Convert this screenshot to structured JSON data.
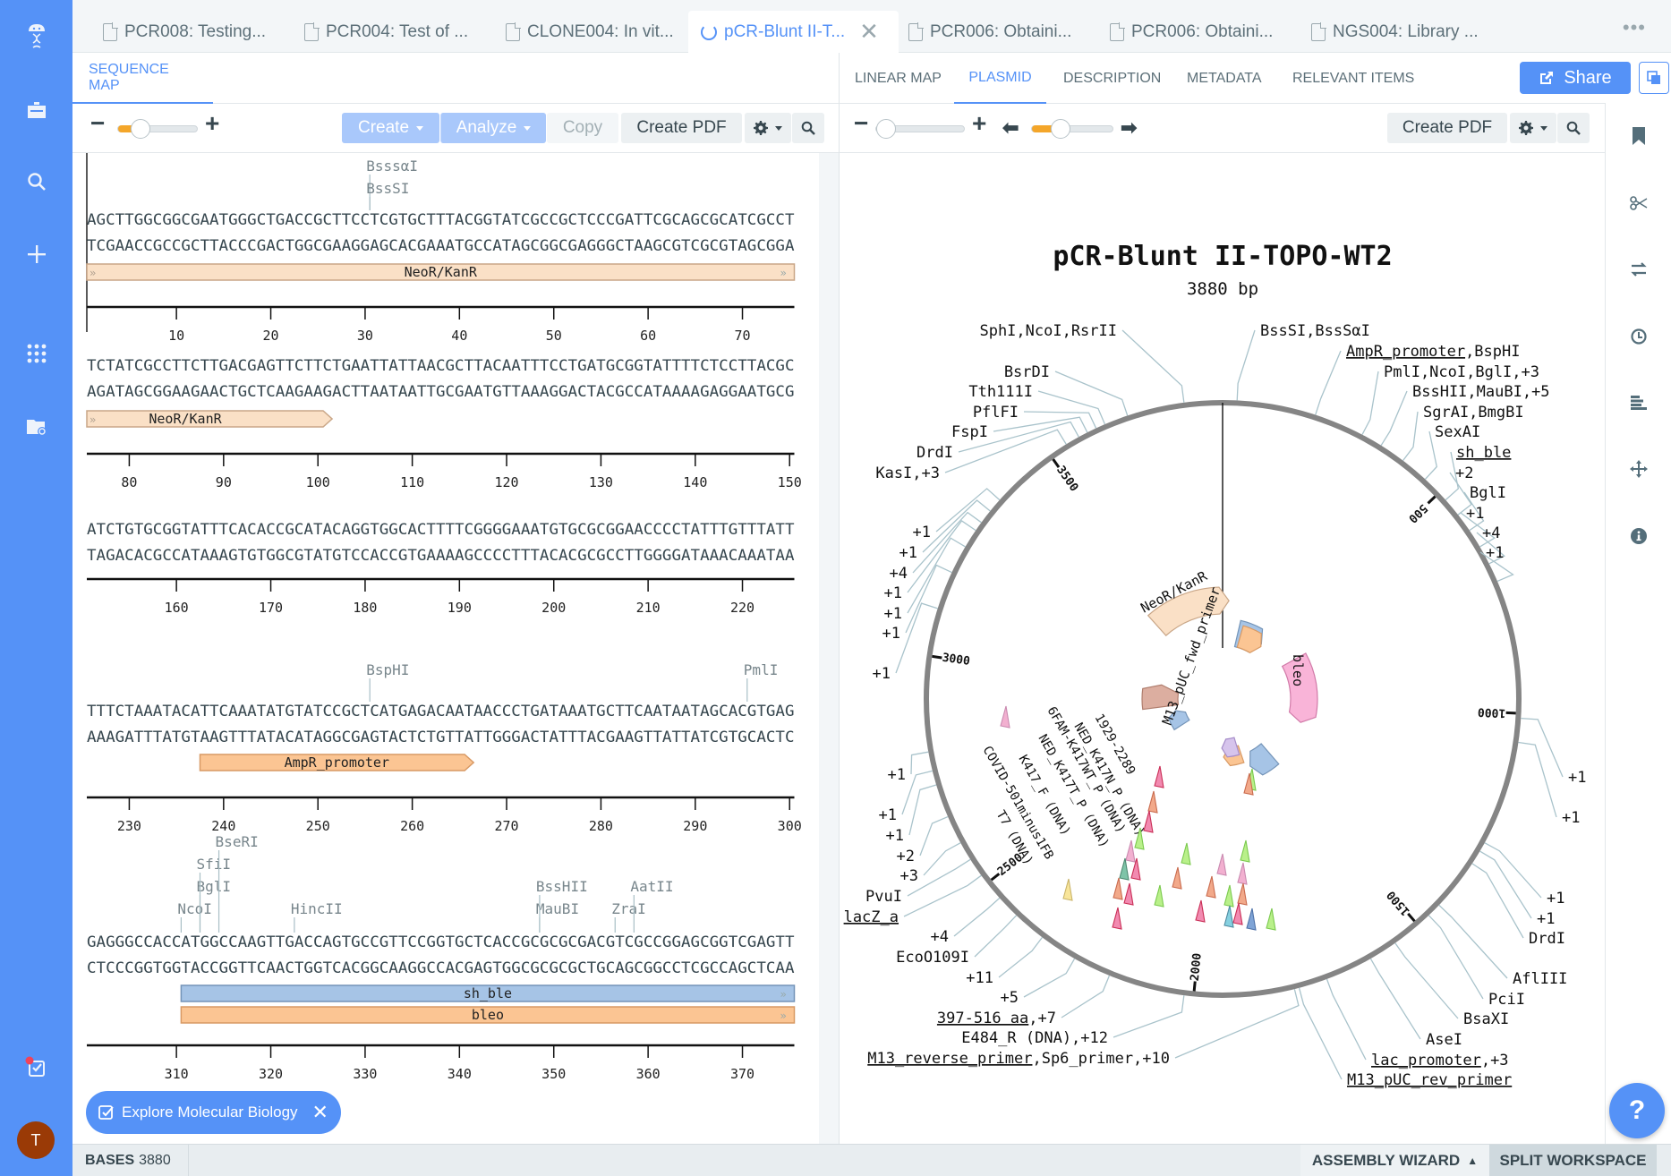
{
  "tabs": [
    {
      "label": "PCR008: Testing...",
      "icon": "document-icon",
      "active": false
    },
    {
      "label": "PCR004: Test of ...",
      "icon": "document-icon",
      "active": false
    },
    {
      "label": "CLONE004: In vit...",
      "icon": "document-icon",
      "active": false
    },
    {
      "label": "pCR-Blunt II-T...",
      "icon": "plasmid-icon",
      "active": true
    },
    {
      "label": "PCR006: Obtaini...",
      "icon": "document-icon",
      "active": false
    },
    {
      "label": "PCR006: Obtaini...",
      "icon": "document-icon",
      "active": false
    },
    {
      "label": "NGS004: Library ...",
      "icon": "document-icon",
      "active": false
    }
  ],
  "tabs_more": "•••",
  "left_panel": {
    "subtab": "SEQUENCE MAP",
    "toolbar": {
      "zoom_level": 0.2,
      "create": "Create",
      "analyze": "Analyze",
      "copy": "Copy",
      "create_pdf": "Create PDF"
    },
    "rows": [
      {
        "top": "AGCTTGGCGGCGAATGGGCTGACCGCTTCCTCGTGCTTTACGGTATCGCCGCTCCCGATTCGCAGCGCATCGCCT",
        "bottom": "TCGAACCGCCGCTTACCCGACTGGCGAAGGAGCACGAAATGCCATAGCGGCGAGGGCTAAGCGTCGCGTAGCGGA",
        "start": 1,
        "ticks": [
          "10",
          "20",
          "30",
          "40",
          "50",
          "60",
          "70"
        ],
        "enzymes": [
          {
            "name": "BsssαI",
            "pos": 30,
            "level": 1
          },
          {
            "name": "BssSI",
            "pos": 30,
            "level": 0
          }
        ],
        "features": [
          {
            "name": "NeoR/KanR",
            "from": 1,
            "to": 75,
            "color": "#fae0c6",
            "stroke": "#c9a687",
            "cont_left": true,
            "cont_right": true
          }
        ]
      },
      {
        "top": "TCTATCGCCTTCTTGACGAGTTCTTCTGAATTATTAACGCTTACAATTTCCTGATGCGGTATTTTCTCCTTACGC",
        "bottom": "AGATAGCGGAAGAACTGCTCAAGAAGACTTAATAATTGCGAATGTTAAAGGACTACGCCATAAAAGAGGAATGCG",
        "start": 76,
        "ticks": [
          "80",
          "90",
          "100",
          "110",
          "120",
          "130",
          "140",
          "150"
        ],
        "enzymes": [],
        "features": [
          {
            "name": "NeoR/KanR",
            "from": 76,
            "to": 101,
            "color": "#fae0c6",
            "stroke": "#c9a687",
            "cont_left": true,
            "arrow": true
          }
        ]
      },
      {
        "top": "ATCTGTGCGGTATTTCACACCGCATACAGGTGGCACTTTTCGGGGAAATGTGCGCGGAACCCCTATTTGTTTATT",
        "bottom": "TAGACACGCCATAAAGTGTGGCGTATGTCCACCGTGAAAAGCCCCTTTACACGCGCCTTGGGGATAAACAAATAA",
        "start": 151,
        "ticks": [
          "160",
          "170",
          "180",
          "190",
          "200",
          "210",
          "220"
        ],
        "enzymes": [],
        "features": []
      },
      {
        "top": "TTTCTAAATACATTCAAATATGTATCCGCTCATGAGACAATAACCCTGATAAATGCTTCAATAATAGCACGTGAG",
        "bottom": "AAAGATTTATGTAAGTTTATACATAGGCGAGTACTCTGTTATTGGGACTATTTACGAAGTTATTATCGTGCACTC",
        "start": 226,
        "ticks": [
          "230",
          "240",
          "250",
          "260",
          "270",
          "280",
          "290",
          "300"
        ],
        "enzymes": [
          {
            "name": "BspHI",
            "pos": 255,
            "level": 0
          },
          {
            "name": "PmlI",
            "pos": 295,
            "level": 0
          }
        ],
        "features": [
          {
            "name": "AmpR_promoter",
            "from": 238,
            "to": 266,
            "color": "#fbc593",
            "stroke": "#d89a65",
            "arrow": true
          }
        ]
      },
      {
        "top": "GAGGGCCACCATGGCCAAGTTGACCAGTGCCGTTCCGGTGCTCACCGCGCGCGACGTCGCCGGAGCGGTCGAGTT",
        "bottom": "CTCCCGGTGGTACCGGTTCAACTGGTCACGGCAAGGCCACGAGTGGCGCGCGCTGCAGCGGCCTCGCCAGCTCAA",
        "start": 301,
        "ticks": [
          "310",
          "320",
          "330",
          "340",
          "350",
          "360",
          "370"
        ],
        "enzymes": [
          {
            "name": "NcoI",
            "pos": 310,
            "level": 0
          },
          {
            "name": "BglI",
            "pos": 312,
            "level": 1
          },
          {
            "name": "SfiI",
            "pos": 312,
            "level": 2
          },
          {
            "name": "BseRI",
            "pos": 314,
            "level": 3
          },
          {
            "name": "HincII",
            "pos": 322,
            "level": 0
          },
          {
            "name": "MauBI",
            "pos": 348,
            "level": 0
          },
          {
            "name": "BssHII",
            "pos": 348,
            "level": 1
          },
          {
            "name": "ZraI",
            "pos": 356,
            "level": 0
          },
          {
            "name": "AatII",
            "pos": 358,
            "level": 1
          }
        ],
        "features": [
          {
            "name": "sh_ble",
            "from": 311,
            "to": 375,
            "color": "#a6c4e6",
            "stroke": "#7494b8",
            "cont_right": true
          },
          {
            "name": "bleo",
            "from": 311,
            "to": 375,
            "color": "#fbc593",
            "stroke": "#d89a65",
            "cont_right": true
          }
        ]
      }
    ]
  },
  "right_panel": {
    "subtabs": [
      "LINEAR MAP",
      "PLASMID",
      "DESCRIPTION",
      "METADATA",
      "RELEVANT ITEMS"
    ],
    "active_subtab": "PLASMID",
    "share": "Share",
    "toolbar": {
      "zoom_level": 0.0,
      "rotate_level": 0.3,
      "create_pdf": "Create PDF"
    }
  },
  "plasmid": {
    "name": "pCR-Blunt II-TOPO-WT2",
    "length_label": "3880 bp",
    "length": 3880,
    "ticks": [
      "500",
      "1000",
      "1500",
      "2000",
      "2500",
      "3000",
      "3500"
    ],
    "labels_top": [
      {
        "text": "SphI,NcoI,RsrII",
        "anchor": "end"
      },
      {
        "text": "BssSI,BssSαI",
        "anchor": "start"
      }
    ],
    "labels_right": [
      {
        "text": "AmpR_promoter",
        "suffix": ",BspHI",
        "underline": true
      },
      {
        "text": "PmlI,NcoI,BglI,+3"
      },
      {
        "text": "BssHII,MauBI,+5"
      },
      {
        "text": "SgrAI,BmgBI"
      },
      {
        "text": "SexAI"
      },
      {
        "text": "sh_ble",
        "underline": true
      },
      {
        "text": "+2"
      },
      {
        "text": "BglI"
      },
      {
        "text": "+1"
      },
      {
        "text": "+4"
      },
      {
        "text": "+1"
      },
      {
        "text": "+1"
      },
      {
        "text": "+1"
      },
      {
        "text": "+1"
      },
      {
        "text": "+1"
      },
      {
        "text": "DrdI"
      },
      {
        "text": "AflIII"
      },
      {
        "text": "PciI"
      },
      {
        "text": "BsaXI"
      },
      {
        "text": "AseI"
      },
      {
        "text": "lac_promoter",
        "suffix": ",+3",
        "underline": true
      },
      {
        "text": "M13_pUC_rev_primer",
        "underline": true
      }
    ],
    "labels_left": [
      {
        "text": "BsrDI"
      },
      {
        "text": "Tth111I"
      },
      {
        "text": "PflFI"
      },
      {
        "text": "FspI"
      },
      {
        "text": "DrdI"
      },
      {
        "text": "KasI,+3"
      },
      {
        "text": "+1"
      },
      {
        "text": "+1"
      },
      {
        "text": "+4"
      },
      {
        "text": "+1"
      },
      {
        "text": "+1"
      },
      {
        "text": "+1"
      },
      {
        "text": "+1"
      },
      {
        "text": "+1"
      },
      {
        "text": "+1"
      },
      {
        "text": "+1"
      },
      {
        "text": "+2"
      },
      {
        "text": "+3"
      },
      {
        "text": "PvuI"
      },
      {
        "text": "lacZ_a",
        "underline": true
      },
      {
        "text": "+4"
      },
      {
        "text": "EcoO109I"
      },
      {
        "text": "+11"
      },
      {
        "text": "+5"
      },
      {
        "text": "397-516 aa",
        "suffix": ",+7",
        "underline": true
      },
      {
        "text": "E484_R (DNA),+12"
      },
      {
        "text": "M13_reverse_primer",
        "suffix": ",Sp6_primer,+10",
        "underline": true
      }
    ],
    "inner_labels": {
      "neor": "NeoR/KanR",
      "m13fwd": "M13_pUC_fwd_primer",
      "bleo": "bleo",
      "primers": [
        "1929-2289",
        "NED_K417N_P (DNA)",
        "6FAM-K417WT_P (DNA)",
        "NED_K417T_P (DNA)",
        "K417_F (DNA)",
        "COVID-501minus1FB",
        "T7 (DNA)"
      ]
    }
  },
  "right_sidebar": [
    "bookmark-icon",
    "scissors-icon",
    "swap-icon",
    "history-icon",
    "align-icon",
    "move-icon",
    "info-icon"
  ],
  "bottom": {
    "bases_label": "BASES",
    "bases_value": "3880",
    "assembly_wizard": "ASSEMBLY WIZARD",
    "split_workspace": "SPLIT WORKSPACE"
  },
  "explore_pill": "Explore Molecular Biology",
  "help": "?",
  "avatar_initial": "T",
  "colors": {
    "accent": "#5592f7",
    "nav_bg": "#5592f7",
    "slider_fill": "#f4a62a",
    "avatar": "#9a3a06"
  }
}
